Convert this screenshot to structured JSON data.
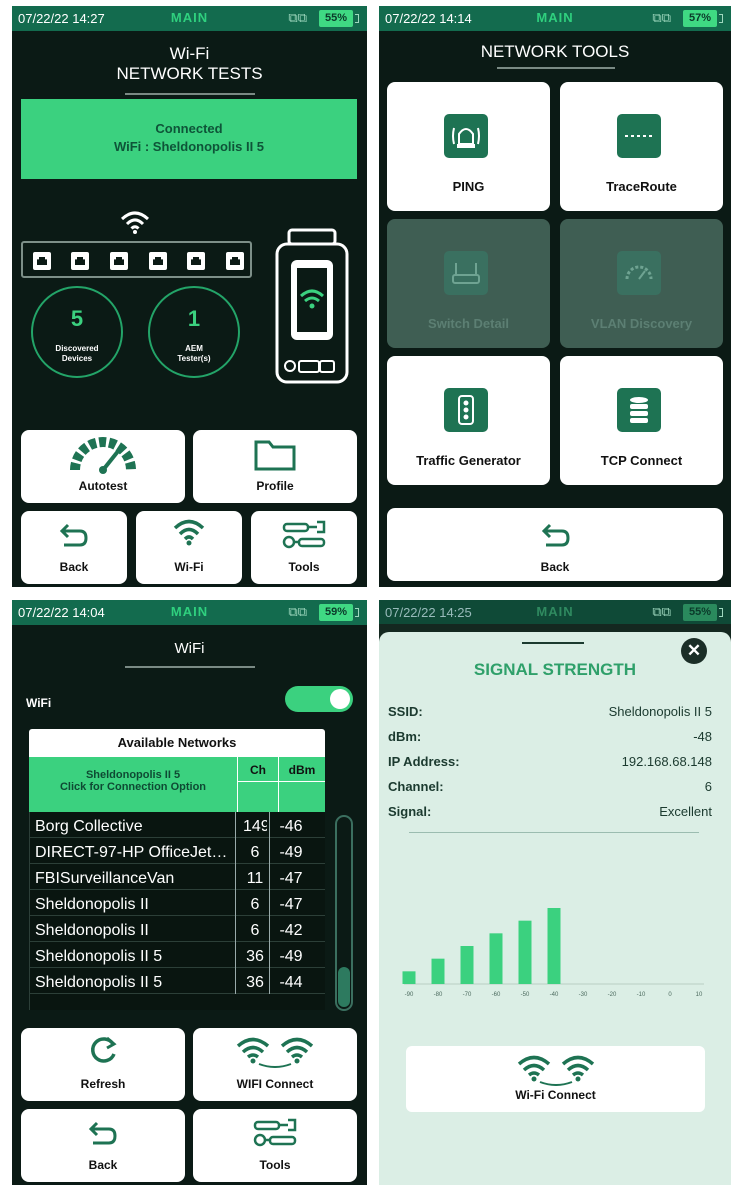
{
  "main": {
    "status": {
      "datetime": "07/22/22 14:27",
      "mode": "MAIN",
      "battery": "55%"
    },
    "title_line1": "Wi-Fi",
    "title_line2": "NETWORK TESTS",
    "banner_line1": "Connected",
    "banner_line2": "WiFi : Sheldonopolis II 5",
    "discovered_count": "5",
    "discovered_label1": "Discovered",
    "discovered_label2": "Devices",
    "tester_count": "1",
    "tester_label1": "AEM",
    "tester_label2": "Tester(s)",
    "buttons": {
      "autotest": "Autotest",
      "profile": "Profile",
      "back": "Back",
      "wifi": "Wi-Fi",
      "tools": "Tools"
    },
    "accent": "#3bd17f"
  },
  "tools": {
    "status": {
      "datetime": "07/22/22 14:14",
      "mode": "MAIN",
      "battery": "57%"
    },
    "title": "NETWORK TOOLS",
    "items": [
      {
        "label": "PING",
        "icon": "ping-icon",
        "enabled": true
      },
      {
        "label": "TraceRoute",
        "icon": "traceroute-icon",
        "enabled": true
      },
      {
        "label": "Switch Detail",
        "icon": "switch-icon",
        "enabled": false
      },
      {
        "label": "VLAN Discovery",
        "icon": "gauge-icon",
        "enabled": false
      },
      {
        "label": "Traffic Generator",
        "icon": "traffic-light-icon",
        "enabled": true
      },
      {
        "label": "TCP Connect",
        "icon": "database-icon",
        "enabled": true
      }
    ],
    "back": "Back"
  },
  "wifi": {
    "status": {
      "datetime": "07/22/22 14:04",
      "mode": "MAIN",
      "battery": "59%"
    },
    "title": "WiFi",
    "toggle_label": "WiFi",
    "toggle_on": true,
    "table_title": "Available Networks",
    "connected_line1": "Sheldonopolis II 5",
    "connected_line2": "Click for Connection Option",
    "col_ch": "Ch",
    "col_dbm": "dBm",
    "networks": [
      {
        "ssid": "Borg Collective",
        "ch": "149",
        "dbm": "-46"
      },
      {
        "ssid": "DIRECT-97-HP OfficeJet 38...",
        "ch": "6",
        "dbm": "-49"
      },
      {
        "ssid": "FBISurveillanceVan",
        "ch": "11",
        "dbm": "-47"
      },
      {
        "ssid": "Sheldonopolis II",
        "ch": "6",
        "dbm": "-47"
      },
      {
        "ssid": "Sheldonopolis II",
        "ch": "6",
        "dbm": "-42"
      },
      {
        "ssid": "Sheldonopolis II 5",
        "ch": "36",
        "dbm": "-49"
      },
      {
        "ssid": "Sheldonopolis II 5",
        "ch": "36",
        "dbm": "-44"
      }
    ],
    "buttons": {
      "refresh": "Refresh",
      "wifi_connect": "WIFI Connect",
      "back": "Back",
      "tools": "Tools"
    }
  },
  "signal": {
    "status": {
      "datetime": "07/22/22 14:25",
      "mode": "MAIN",
      "battery": "55%"
    },
    "title": "SIGNAL STRENGTH",
    "fields": [
      {
        "k": "SSID:",
        "v": "Sheldonopolis II 5"
      },
      {
        "k": "dBm:",
        "v": "-48"
      },
      {
        "k": "IP Address:",
        "v": "192.168.68.148"
      },
      {
        "k": "Channel:",
        "v": "6"
      },
      {
        "k": "Signal:",
        "v": "Excellent"
      }
    ],
    "connect_label": "Wi-Fi Connect",
    "chart_data": {
      "type": "bar",
      "categories": [
        "-90",
        "-80",
        "-70",
        "-60",
        "-50",
        "-40",
        "-30",
        "-20",
        "-10",
        "0",
        "10"
      ],
      "values": [
        1,
        2,
        3,
        4,
        5,
        6,
        0,
        0,
        0,
        0,
        0
      ],
      "title": "",
      "xlabel": "",
      "ylabel": "",
      "color": "#3bd17f"
    }
  }
}
